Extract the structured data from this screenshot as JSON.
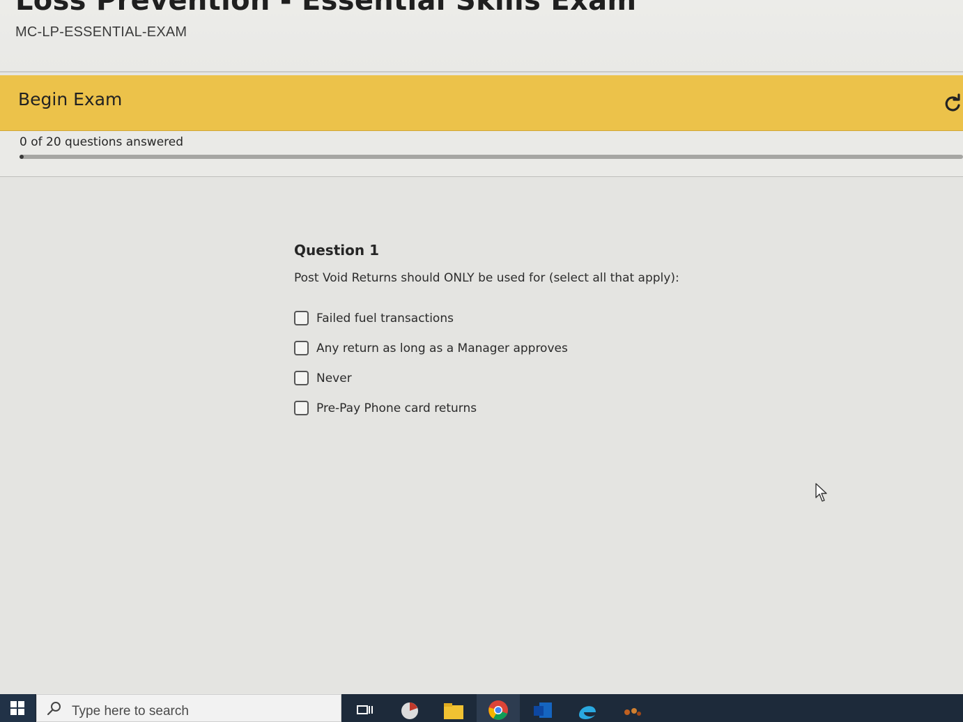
{
  "header": {
    "title": "Loss Prevention - Essential Skills Exam",
    "course_code": "MC-LP-ESSENTIAL-EXAM"
  },
  "banner": {
    "title": "Begin Exam",
    "refresh_icon": "refresh-icon"
  },
  "progress": {
    "text": "0 of 20 questions answered",
    "answered": 0,
    "total": 20
  },
  "question": {
    "heading": "Question 1",
    "text": "Post Void Returns should ONLY be used for (select all that apply):",
    "options": [
      {
        "label": "Failed fuel transactions",
        "checked": false
      },
      {
        "label": "Any return as long as a Manager approves",
        "checked": false
      },
      {
        "label": "Never",
        "checked": false
      },
      {
        "label": "Pre-Pay Phone card returns",
        "checked": false
      }
    ]
  },
  "taskbar": {
    "search_placeholder": "Type here to search",
    "icons": [
      "windows-start-icon",
      "search-icon",
      "task-view-icon",
      "app-icon",
      "file-explorer-icon",
      "chrome-icon",
      "outlook-icon",
      "edge-icon",
      "app-icon"
    ]
  },
  "colors": {
    "banner": "#ecc24a",
    "taskbar": "#1d2a3a",
    "page_background": "#e4e4e1"
  }
}
